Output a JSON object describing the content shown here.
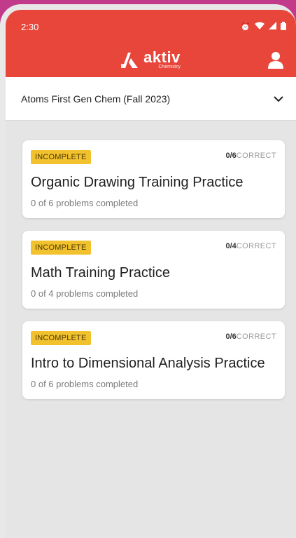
{
  "status": {
    "time": "2:30",
    "icons": [
      "alarm-icon",
      "wifi-icon",
      "signal-icon",
      "battery-icon"
    ]
  },
  "app": {
    "logo_text": "aktiv",
    "logo_sub": "Chemistry"
  },
  "course": {
    "selected": "Atoms First Gen Chem (Fall 2023)"
  },
  "colors": {
    "brand": "#e8463a",
    "badge": "#f2c12e"
  },
  "assignments": [
    {
      "status": "INCOMPLETE",
      "score": "0/6",
      "score_label": "CORRECT",
      "title": "Organic Drawing Training Practice",
      "progress": "0 of 6 problems completed"
    },
    {
      "status": "INCOMPLETE",
      "score": "0/4",
      "score_label": "CORRECT",
      "title": "Math Training Practice",
      "progress": "0 of 4 problems completed"
    },
    {
      "status": "INCOMPLETE",
      "score": "0/6",
      "score_label": "CORRECT",
      "title": "Intro to Dimensional Analysis Practice",
      "progress": "0 of 6 problems completed"
    }
  ]
}
